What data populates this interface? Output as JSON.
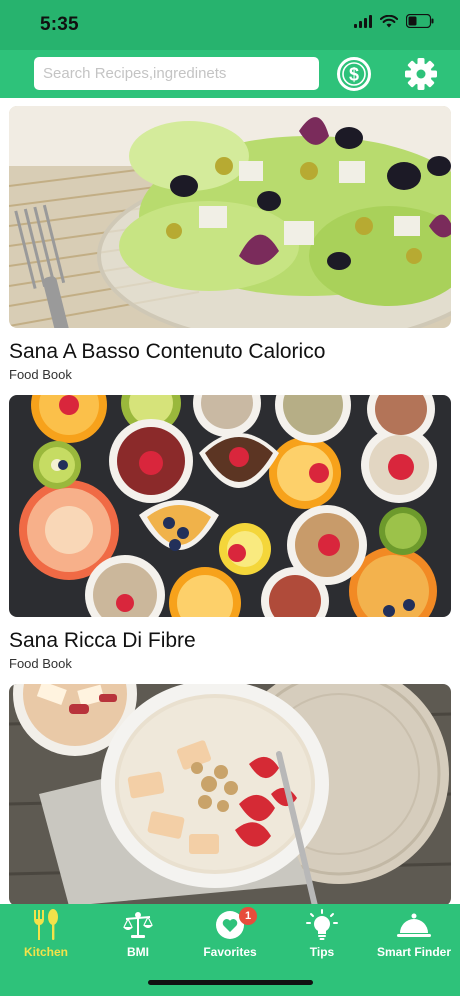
{
  "status_bar": {
    "time": "5:35"
  },
  "header": {
    "search": {
      "placeholder": "Search Recipes,ingredinets",
      "value": ""
    },
    "icons": [
      "dollar-coin-icon",
      "gear-icon"
    ]
  },
  "feed": {
    "cards": [
      {
        "title": "Sana A Basso Contenuto Calorico",
        "source": "Food Book",
        "image": "salad-bowl-photo"
      },
      {
        "title": "Sana Ricca Di Fibre",
        "source": "Food Book",
        "image": "fruit-and-grains-bowls-photo"
      },
      {
        "title": "",
        "source": "",
        "image": "oatmeal-bowl-photo"
      }
    ]
  },
  "tab_bar": {
    "tabs": [
      {
        "label": "Kitchen",
        "icon": "utensils-icon",
        "active": true
      },
      {
        "label": "BMI",
        "icon": "scale-icon",
        "active": false
      },
      {
        "label": "Favorites",
        "icon": "heart-icon",
        "active": false,
        "badge": "1"
      },
      {
        "label": "Tips",
        "icon": "lightbulb-icon",
        "active": false
      },
      {
        "label": "Smart Finder",
        "icon": "cloche-icon",
        "active": false
      }
    ]
  },
  "colors": {
    "status_bar": "#27b36e",
    "header": "#2ec27a",
    "tab_active": "#f3e24a",
    "badge": "#e74c3c"
  }
}
